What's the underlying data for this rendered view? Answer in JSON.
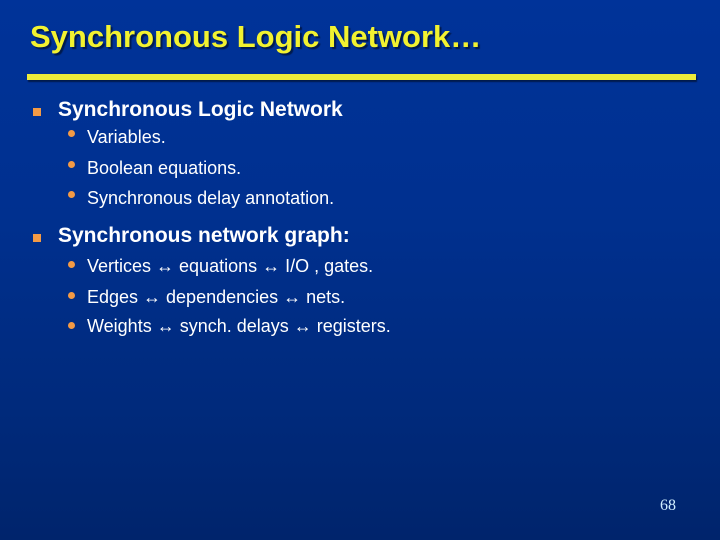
{
  "slide": {
    "title": "Synchronous Logic Network…",
    "page_number": "68",
    "colors": {
      "background_top": "#003399",
      "background_bottom": "#00246c",
      "title": "#f2f230",
      "rule": "#ecec3a",
      "bullet": "#f39a45",
      "text": "#ffffff",
      "page_number": "#cfeeff"
    }
  },
  "bullets": [
    {
      "icon": "square-bullet-icon",
      "text": "Synchronous Logic Network",
      "sub": [
        {
          "icon": "dot-bullet-icon",
          "text": "Variables."
        },
        {
          "icon": "dot-bullet-icon",
          "text": "Boolean equations."
        },
        {
          "icon": "dot-bullet-icon",
          "text": "Synchronous delay annotation."
        }
      ]
    },
    {
      "icon": "square-bullet-icon",
      "text": "Synchronous network graph:",
      "sub": [
        {
          "icon": "dot-bullet-icon",
          "text": "Vertices ↔ equations ↔ I/O , gates."
        },
        {
          "icon": "dot-bullet-icon",
          "text": "Edges ↔ dependencies ↔ nets."
        },
        {
          "icon": "dot-bullet-icon",
          "text": "Weights ↔ synch. delays ↔ registers."
        }
      ]
    }
  ]
}
